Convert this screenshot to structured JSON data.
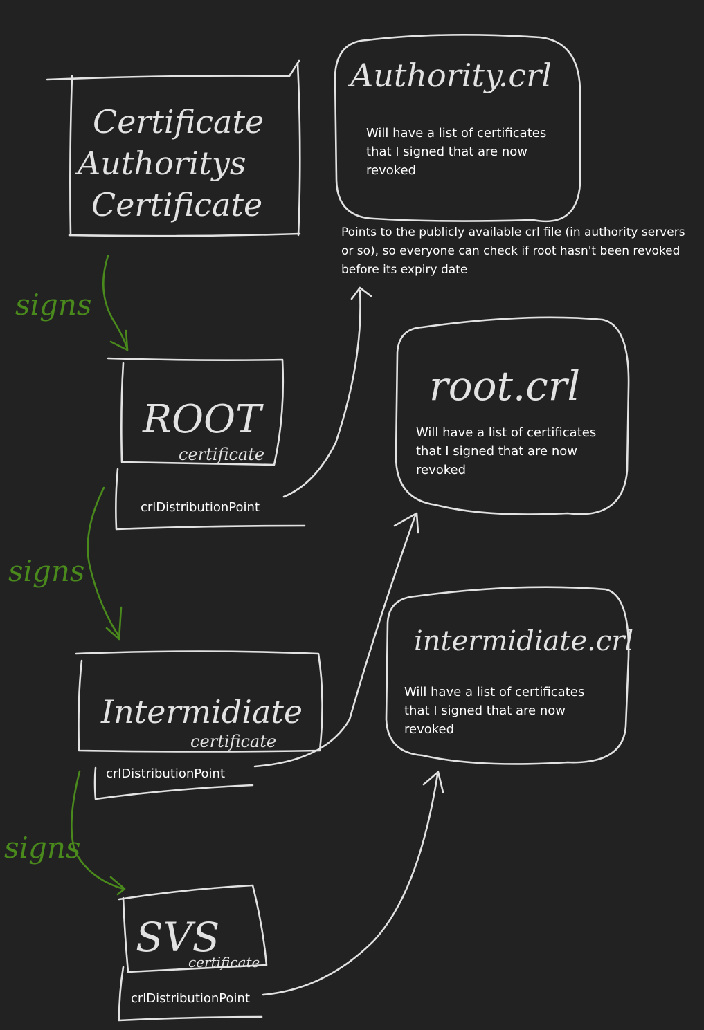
{
  "colors": {
    "background": "#222222",
    "ink": "#e2e2e2",
    "text": "#ffffff",
    "signs_arrow": "#4a8a1c"
  },
  "ca_certificate": {
    "title": "Certificate Authoritys Certificate"
  },
  "authority_crl": {
    "title": "Authority.crl",
    "description": "Will have a list of certificates\nthat I signed that are now\nrevoked"
  },
  "crl_pointer_note": "Points to the publicly available crl file (in authority servers\nor so), so everyone can check if root hasn't been revoked\nbefore its expiry date",
  "root_certificate": {
    "title": "ROOT",
    "subtitle": "certificate",
    "field": "crlDistributionPoint"
  },
  "root_crl": {
    "title": "root.crl",
    "description": "Will have a list of certificates\nthat I signed that are now\nrevoked"
  },
  "intermediate_certificate": {
    "title": "Intermidiate",
    "subtitle": "certificate",
    "field": "crlDistributionPoint"
  },
  "intermediate_crl": {
    "title": "intermidiate.crl",
    "description": "Will have a list of certificates\nthat I signed that are now\nrevoked"
  },
  "svs_certificate": {
    "title": "SVS",
    "subtitle": "certificate",
    "field": "crlDistributionPoint"
  },
  "signs_labels": [
    "signs",
    "signs",
    "signs"
  ]
}
